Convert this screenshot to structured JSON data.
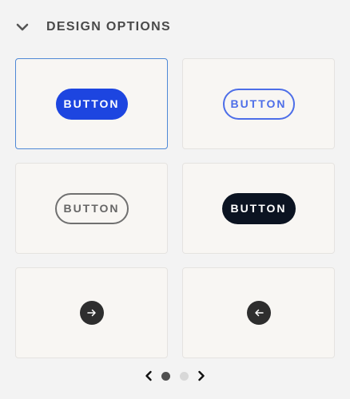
{
  "section": {
    "title": "DESIGN OPTIONS",
    "collapse_icon": "chevron-down-icon"
  },
  "options": [
    {
      "label": "BUTTON",
      "style": "filled-blue",
      "selected": true
    },
    {
      "label": "BUTTON",
      "style": "outline-blue",
      "selected": false
    },
    {
      "label": "BUTTON",
      "style": "outline-gray",
      "selected": false
    },
    {
      "label": "BUTTON",
      "style": "filled-dark",
      "selected": false
    },
    {
      "icon": "arrow-right-icon",
      "style": "circle-dark",
      "selected": false
    },
    {
      "icon": "arrow-left-icon",
      "style": "circle-dark",
      "selected": false
    }
  ],
  "pagination": {
    "current_page": 1,
    "total_pages": 2,
    "prev_icon": "chevron-left-icon",
    "next_icon": "chevron-right-icon"
  },
  "colors": {
    "selected_border": "#4e88d6",
    "filled_blue": "#1d45e0",
    "outline_blue": "#4d6ee8",
    "dark": "#0b1321",
    "card_bg": "#f8f6f3"
  }
}
